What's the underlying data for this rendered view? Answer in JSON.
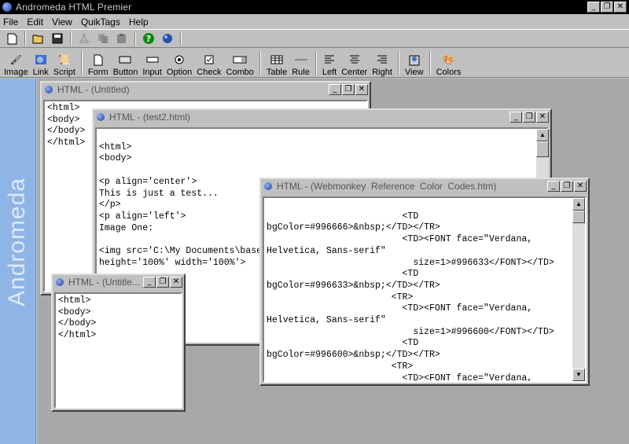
{
  "app": {
    "title": "Andromeda HTML Premier"
  },
  "window_controls": {
    "minimize": "_",
    "restore": "❐",
    "close": "✕"
  },
  "menu": [
    "File",
    "Edit",
    "View",
    "QuikTags",
    "Help"
  ],
  "std_toolbar": [
    "new-icon",
    "open-icon",
    "save-icon",
    "cut-icon",
    "copy-icon",
    "paste-icon",
    "help-icon",
    "web-icon"
  ],
  "tag_toolbar": {
    "image": "Image",
    "link": "Link",
    "script": "Script",
    "form": "Form",
    "button": "Button",
    "input": "Input",
    "option": "Option",
    "check": "Check",
    "combo": "Combo",
    "table": "Table",
    "rule": "Rule",
    "left": "Left",
    "center": "Center",
    "right": "Right",
    "view": "View",
    "colors": "Colors"
  },
  "sidebar": {
    "brand": "Andromeda"
  },
  "windows": {
    "untitled": {
      "title": "HTML - (Untitled)",
      "code": "<html>\n<body>\n</body>\n</html>"
    },
    "test2": {
      "title": "HTML - (test2.html)",
      "code": "\n<html>\n<body>\n\n<p align='center'>\nThis is just a test...\n</p>\n<p align='left'>\nImage One:\n\n<img src='C:\\My Documents\\base\nheight='100%' width='100%'>"
    },
    "untitled2": {
      "title": "HTML - (Untitle...",
      "code": "<html>\n<body>\n</body>\n</html>"
    },
    "webmonkey": {
      "title": "HTML - (Webmonkey  Reference  Color  Codes.htm)",
      "code": "\n                         <TD\nbgColor=#996666>&nbsp;</TD></TR>\n                         <TD><FONT face=\"Verdana,\nHelvetica, Sans-serif\"\n                           size=1>#996633</FONT></TD>\n                         <TD\nbgColor=#996633>&nbsp;</TD></TR>\n                       <TR>\n                         <TD><FONT face=\"Verdana,\nHelvetica, Sans-serif\"\n                           size=1>#996600</FONT></TD>\n                         <TD\nbgColor=#996600>&nbsp;</TD></TR>\n                       <TR>\n                         <TD><FONT face=\"Verdana,"
    }
  }
}
